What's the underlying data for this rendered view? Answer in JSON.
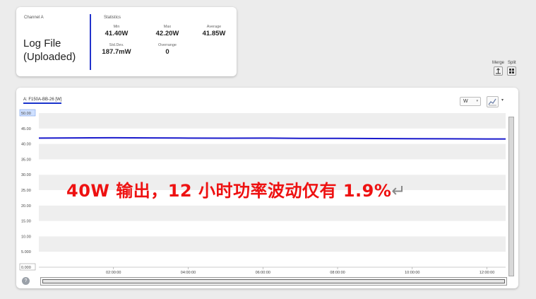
{
  "channel": {
    "label": "Channel A",
    "title_line1": "Log File",
    "title_line2": "(Uploaded)"
  },
  "statistics": {
    "label": "Statistics",
    "min_label": "Min",
    "min_value": "41.40W",
    "max_label": "Max",
    "max_value": "42.20W",
    "avg_label": "Average",
    "avg_value": "41.85W",
    "std_label": "Std.Dev.",
    "std_value": "187.7mW",
    "over_label": "Overrange",
    "over_value": "0"
  },
  "view_toggle": {
    "merge_label": "Merge",
    "split_label": "Split"
  },
  "chart_toolbar": {
    "series_tab": "A: F150A-BB-26 [W]",
    "unit_value": "W",
    "unit_caret": "▾",
    "chart_type_caret": "▾",
    "help_label": "?"
  },
  "overlay": {
    "caption": "40W 输出，12 小时功率波动仅有 1.9%",
    "return_glyph": "↵"
  },
  "colors": {
    "series": "#1a1acc",
    "accent": "#2233cc",
    "caption": "#ee1111"
  },
  "chart_data": {
    "type": "line",
    "ylim": [
      0,
      50
    ],
    "y_tick_labels": [
      "50.00",
      "45.00",
      "40.00",
      "35.00",
      "30.00",
      "25.00",
      "20.00",
      "15.00",
      "10.00",
      "5.000",
      "0.000"
    ],
    "x_tick_labels": [
      "02:00:00",
      "04:00:00",
      "06:00:00",
      "08:00:00",
      "10:00:00",
      "12:00:00"
    ],
    "x_hours": [
      2,
      4,
      6,
      8,
      10,
      12
    ],
    "xlim_hours": [
      0,
      12.5
    ],
    "grid": "alternating bands",
    "series": [
      {
        "x_hours": [
          0,
          1,
          2,
          3,
          4,
          5,
          6,
          7,
          8,
          9,
          10,
          11,
          12,
          12.5
        ],
        "values": [
          41.9,
          41.95,
          42.0,
          41.95,
          41.9,
          41.85,
          41.9,
          41.8,
          41.8,
          41.75,
          41.7,
          41.65,
          41.6,
          41.6
        ]
      }
    ]
  }
}
